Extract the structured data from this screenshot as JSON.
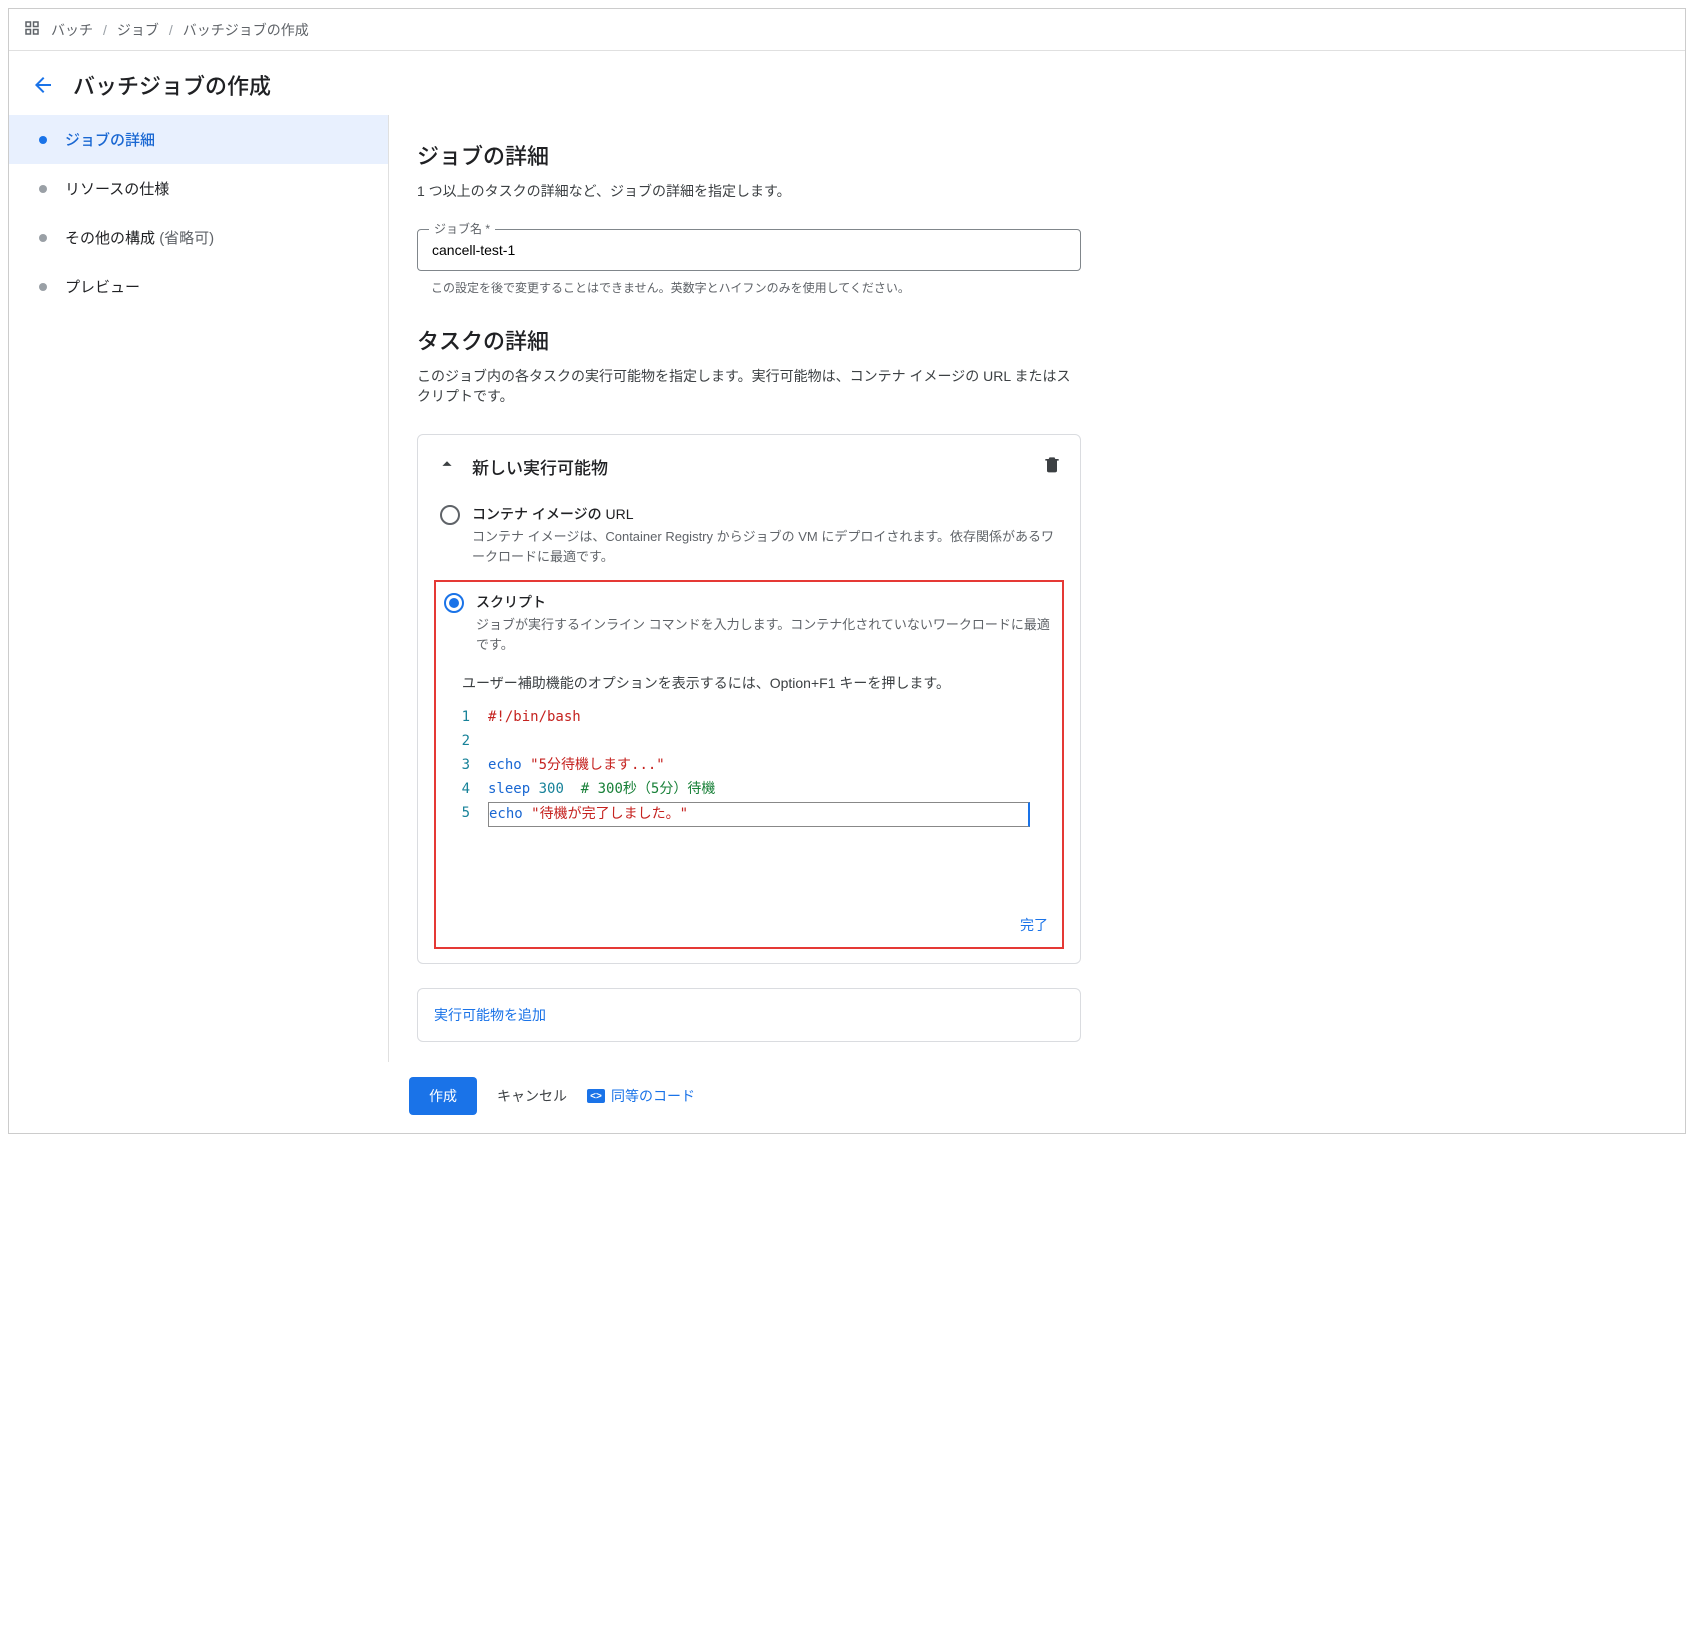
{
  "breadcrumb": {
    "items": [
      "バッチ",
      "ジョブ",
      "バッチジョブの作成"
    ]
  },
  "header": {
    "title": "バッチジョブの作成"
  },
  "sidebar": {
    "items": [
      {
        "label": "ジョブの詳細",
        "active": true
      },
      {
        "label": "リソースの仕様",
        "active": false
      },
      {
        "label": "その他の構成",
        "optional": "(省略可)",
        "active": false
      },
      {
        "label": "プレビュー",
        "active": false
      }
    ]
  },
  "main": {
    "job_details_title": "ジョブの詳細",
    "job_details_sub": "1 つ以上のタスクの詳細など、ジョブの詳細を指定します。",
    "job_name_label": "ジョブ名 *",
    "job_name_value": "cancell-test-1",
    "job_name_helper": "この設定を後で変更することはできません。英数字とハイフンのみを使用してください。",
    "task_details_title": "タスクの詳細",
    "task_details_sub": "このジョブ内の各タスクの実行可能物を指定します。実行可能物は、コンテナ イメージの URL またはスクリプトです。",
    "runnable": {
      "panel_title": "新しい実行可能物",
      "container_label": "コンテナ イメージの URL",
      "container_desc": "コンテナ イメージは、Container Registry からジョブの VM にデプロイされます。依存関係があるワークロードに最適です。",
      "script_label": "スクリプト",
      "script_desc": "ジョブが実行するインライン コマンドを入力します。コンテナ化されていないワークロードに最適です。",
      "a11y_hint": "ユーザー補助機能のオプションを表示するには、Option+F1 キーを押します。",
      "script_lines": [
        "#!/bin/bash",
        "",
        "echo \"5分待機します...\"",
        "sleep 300  # 300秒（5分）待機",
        "echo \"待機が完了しました。\""
      ],
      "done_label": "完了"
    },
    "add_runnable_label": "実行可能物を追加"
  },
  "footer": {
    "create": "作成",
    "cancel": "キャンセル",
    "equivalent_code": "同等のコード"
  }
}
